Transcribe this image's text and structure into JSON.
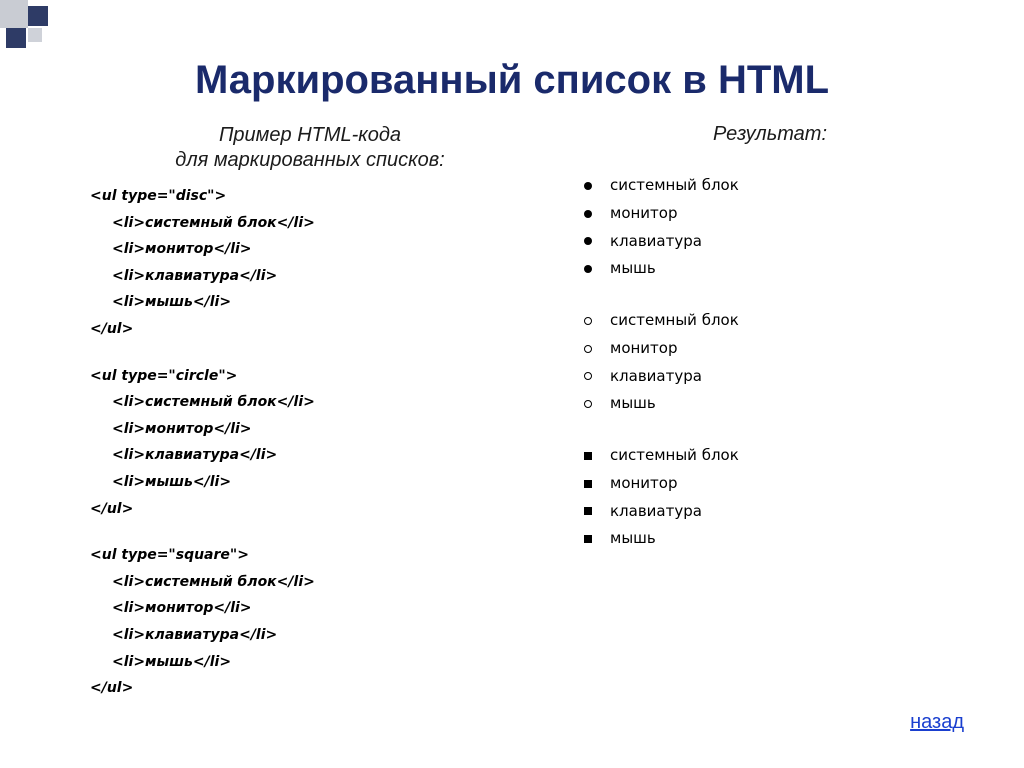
{
  "title": "Маркированный список в HTML",
  "left_heading_line1": "Пример HTML-кода",
  "left_heading_line2": "для маркированных списков:",
  "right_heading": "Результат:",
  "code_blocks": [
    {
      "open": "<ul type=\"disc\">",
      "items": [
        "<li>системный блок</li>",
        "<li>монитор</li>",
        "<li>клавиатура</li>",
        "<li>мышь</li>"
      ],
      "close": "</ul>"
    },
    {
      "open": "<ul type=\"circle\">",
      "items": [
        "<li>системный блок</li>",
        "<li>монитор</li>",
        "<li>клавиатура</li>",
        "<li>мышь</li>"
      ],
      "close": "</ul>"
    },
    {
      "open": "<ul type=\"square\">",
      "items": [
        "<li>системный блок</li>",
        "<li>монитор</li>",
        "<li>клавиатура</li>",
        "<li>мышь</li>"
      ],
      "close": "</ul>"
    }
  ],
  "result_lists": [
    {
      "bullet": "disc",
      "items": [
        "системный блок",
        "монитор",
        "клавиатура",
        "мышь"
      ]
    },
    {
      "bullet": "circle",
      "items": [
        "системный блок",
        "монитор",
        "клавиатура",
        "мышь"
      ]
    },
    {
      "bullet": "square",
      "items": [
        "системный блок",
        "монитор",
        "клавиатура",
        "мышь"
      ]
    }
  ],
  "back_link": "назад"
}
